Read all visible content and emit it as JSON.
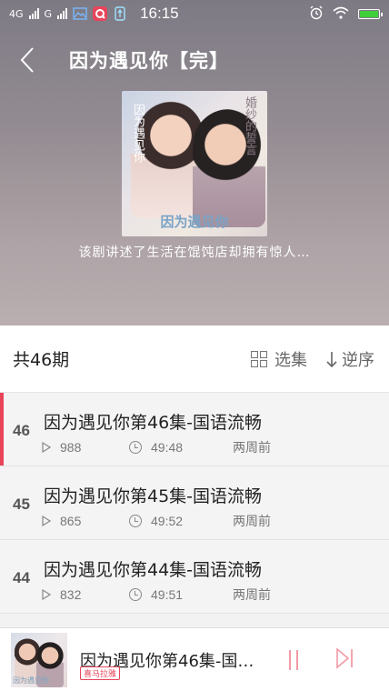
{
  "status_bar": {
    "network_1": "4G",
    "network_2": "G",
    "time": "16:15"
  },
  "header": {
    "title": "因为遇见你【完】",
    "cover_text_left": "因为遇见你",
    "cover_text_right": "婚纱的誓言",
    "cover_text_bottom": "因为遇见你",
    "description": "该剧讲述了生活在馄饨店却拥有惊人…"
  },
  "toolbar": {
    "count_label": "共46期",
    "select_label": "选集",
    "sort_label": "逆序"
  },
  "episodes": [
    {
      "number": "46",
      "title": "因为遇见你第46集-国语流畅",
      "plays": "988",
      "duration": "49:48",
      "ago": "两周前"
    },
    {
      "number": "45",
      "title": "因为遇见你第45集-国语流畅",
      "plays": "865",
      "duration": "49:52",
      "ago": "两周前"
    },
    {
      "number": "44",
      "title": "因为遇见你第44集-国语流畅",
      "plays": "832",
      "duration": "49:51",
      "ago": "两周前"
    }
  ],
  "player": {
    "title": "因为遇见你第46集-国…",
    "badge": "喜马拉雅",
    "thumb_text": "因为遇见你"
  },
  "colors": {
    "accent": "#e8445a",
    "pause": "#f19aa6"
  }
}
